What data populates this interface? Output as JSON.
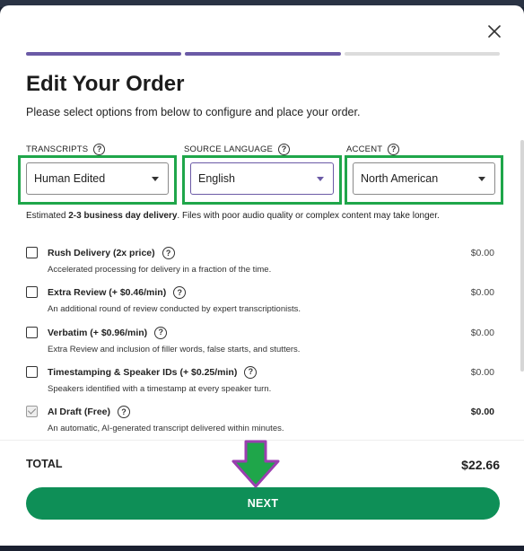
{
  "modal": {
    "title": "Edit Your Order",
    "subtitle": "Please select options from below to configure and place your order.",
    "close_icon": "close-icon",
    "progress": {
      "steps_total": 3,
      "steps_completed": 2,
      "accent_color": "#6b5aa6"
    }
  },
  "fields": {
    "transcripts": {
      "label": "TRANSCRIPTS",
      "value": "Human Edited"
    },
    "source_language": {
      "label": "SOURCE LANGUAGE",
      "value": "English"
    },
    "accent": {
      "label": "ACCENT",
      "value": "North American"
    }
  },
  "estimate": {
    "prefix": "Estimated ",
    "bold": "2-3 business day delivery",
    "suffix": ". Files with poor audio quality or complex content may take longer."
  },
  "options": [
    {
      "name": "Rush Delivery (2x price)",
      "desc": "Accelerated processing for delivery in a fraction of the time.",
      "price": "$0.00",
      "checked": false
    },
    {
      "name": "Extra Review (+ $0.46/min)",
      "desc": "An additional round of review conducted by expert transcriptionists.",
      "price": "$0.00",
      "checked": false
    },
    {
      "name": "Verbatim (+ $0.96/min)",
      "desc": "Extra Review and inclusion of filler words, false starts, and stutters.",
      "price": "$0.00",
      "checked": false
    },
    {
      "name": "Timestamping & Speaker IDs (+ $0.25/min)",
      "desc": "Speakers identified with a timestamp at every speaker turn.",
      "price": "$0.00",
      "checked": false
    },
    {
      "name": "AI Draft (Free)",
      "desc": "An automatic, AI-generated transcript delivered within minutes.",
      "price": "$0.00",
      "checked": true
    }
  ],
  "footer": {
    "total_label": "TOTAL",
    "total_value": "$22.66",
    "next_label": "NEXT"
  },
  "colors": {
    "primary": "#0e8f57",
    "highlight_box": "#1fa64a",
    "annotation_arrow_fill": "#1fa64a",
    "annotation_arrow_stroke": "#9b3fb0"
  }
}
